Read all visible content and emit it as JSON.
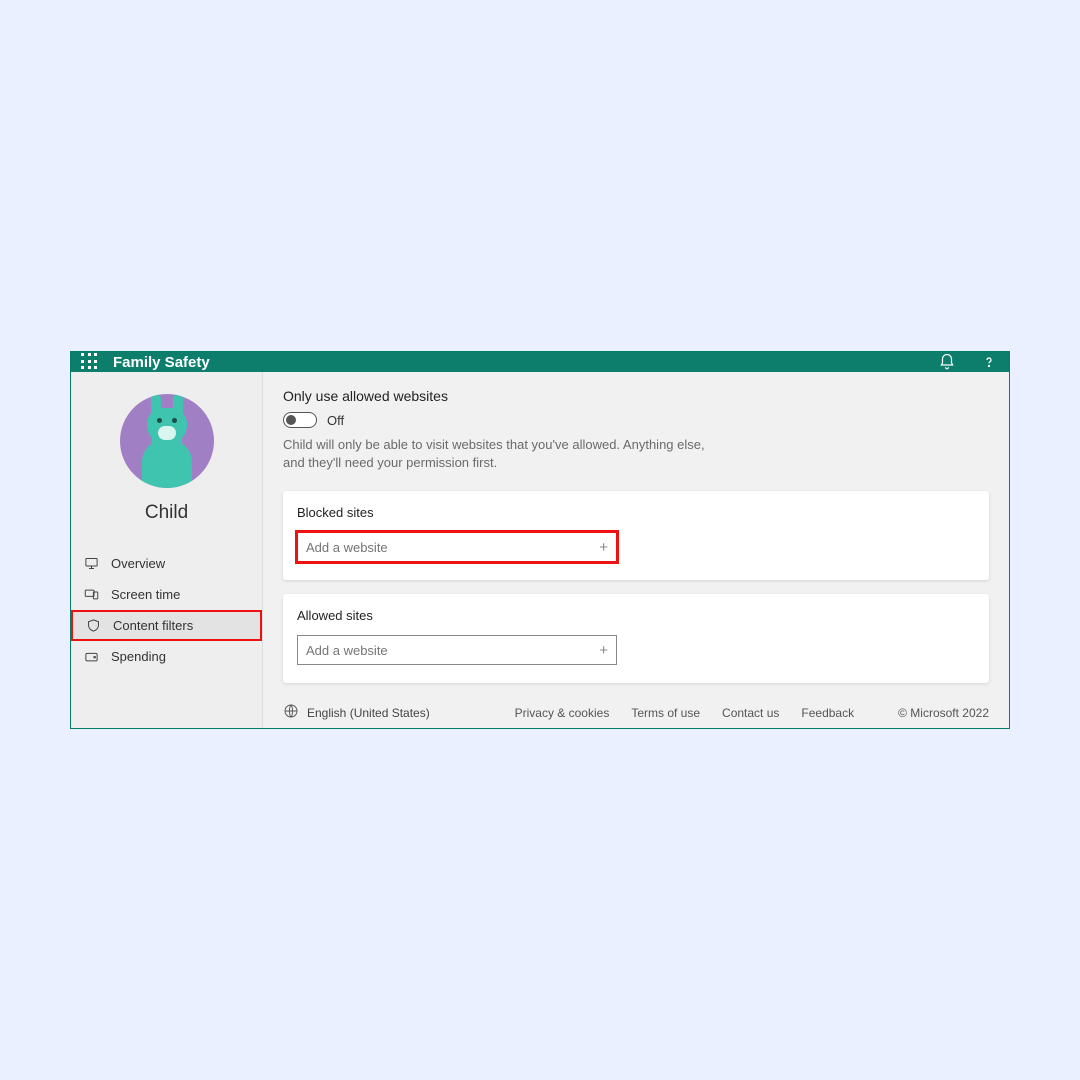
{
  "header": {
    "app_title": "Family Safety"
  },
  "sidebar": {
    "profile_name": "Child",
    "items": [
      {
        "label": "Overview",
        "icon": "monitor-icon"
      },
      {
        "label": "Screen time",
        "icon": "devices-icon"
      },
      {
        "label": "Content filters",
        "icon": "shield-icon"
      },
      {
        "label": "Spending",
        "icon": "wallet-icon"
      }
    ],
    "active_index": 2
  },
  "main": {
    "section_title": "Only use allowed websites",
    "toggle_state": "Off",
    "description": "Child will only be able to visit websites that you've allowed. Anything else, and they'll need your permission first.",
    "blocked": {
      "title": "Blocked sites",
      "placeholder": "Add a website"
    },
    "allowed": {
      "title": "Allowed sites",
      "placeholder": "Add a website"
    }
  },
  "footer": {
    "language": "English (United States)",
    "links": [
      "Privacy & cookies",
      "Terms of use",
      "Contact us",
      "Feedback"
    ],
    "copyright": "© Microsoft 2022"
  }
}
